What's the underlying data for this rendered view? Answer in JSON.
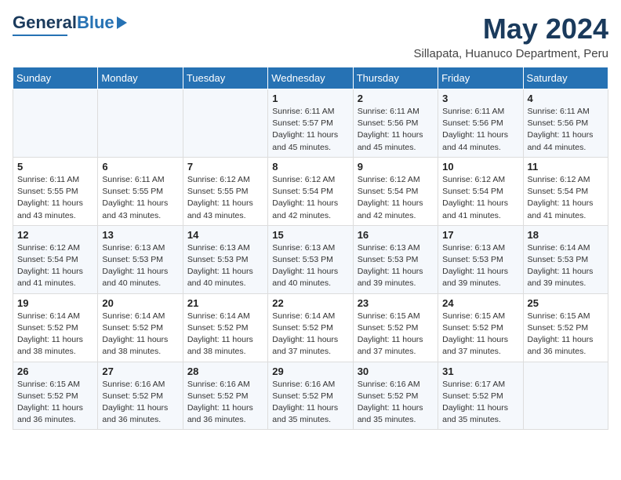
{
  "header": {
    "logo_general": "General",
    "logo_blue": "Blue",
    "month_year": "May 2024",
    "location": "Sillapata, Huanuco Department, Peru"
  },
  "days_of_week": [
    "Sunday",
    "Monday",
    "Tuesday",
    "Wednesday",
    "Thursday",
    "Friday",
    "Saturday"
  ],
  "weeks": [
    [
      {
        "day": "",
        "sunrise": "",
        "sunset": "",
        "daylight": ""
      },
      {
        "day": "",
        "sunrise": "",
        "sunset": "",
        "daylight": ""
      },
      {
        "day": "",
        "sunrise": "",
        "sunset": "",
        "daylight": ""
      },
      {
        "day": "1",
        "sunrise": "Sunrise: 6:11 AM",
        "sunset": "Sunset: 5:57 PM",
        "daylight": "Daylight: 11 hours and 45 minutes."
      },
      {
        "day": "2",
        "sunrise": "Sunrise: 6:11 AM",
        "sunset": "Sunset: 5:56 PM",
        "daylight": "Daylight: 11 hours and 45 minutes."
      },
      {
        "day": "3",
        "sunrise": "Sunrise: 6:11 AM",
        "sunset": "Sunset: 5:56 PM",
        "daylight": "Daylight: 11 hours and 44 minutes."
      },
      {
        "day": "4",
        "sunrise": "Sunrise: 6:11 AM",
        "sunset": "Sunset: 5:56 PM",
        "daylight": "Daylight: 11 hours and 44 minutes."
      }
    ],
    [
      {
        "day": "5",
        "sunrise": "Sunrise: 6:11 AM",
        "sunset": "Sunset: 5:55 PM",
        "daylight": "Daylight: 11 hours and 43 minutes."
      },
      {
        "day": "6",
        "sunrise": "Sunrise: 6:11 AM",
        "sunset": "Sunset: 5:55 PM",
        "daylight": "Daylight: 11 hours and 43 minutes."
      },
      {
        "day": "7",
        "sunrise": "Sunrise: 6:12 AM",
        "sunset": "Sunset: 5:55 PM",
        "daylight": "Daylight: 11 hours and 43 minutes."
      },
      {
        "day": "8",
        "sunrise": "Sunrise: 6:12 AM",
        "sunset": "Sunset: 5:54 PM",
        "daylight": "Daylight: 11 hours and 42 minutes."
      },
      {
        "day": "9",
        "sunrise": "Sunrise: 6:12 AM",
        "sunset": "Sunset: 5:54 PM",
        "daylight": "Daylight: 11 hours and 42 minutes."
      },
      {
        "day": "10",
        "sunrise": "Sunrise: 6:12 AM",
        "sunset": "Sunset: 5:54 PM",
        "daylight": "Daylight: 11 hours and 41 minutes."
      },
      {
        "day": "11",
        "sunrise": "Sunrise: 6:12 AM",
        "sunset": "Sunset: 5:54 PM",
        "daylight": "Daylight: 11 hours and 41 minutes."
      }
    ],
    [
      {
        "day": "12",
        "sunrise": "Sunrise: 6:12 AM",
        "sunset": "Sunset: 5:54 PM",
        "daylight": "Daylight: 11 hours and 41 minutes."
      },
      {
        "day": "13",
        "sunrise": "Sunrise: 6:13 AM",
        "sunset": "Sunset: 5:53 PM",
        "daylight": "Daylight: 11 hours and 40 minutes."
      },
      {
        "day": "14",
        "sunrise": "Sunrise: 6:13 AM",
        "sunset": "Sunset: 5:53 PM",
        "daylight": "Daylight: 11 hours and 40 minutes."
      },
      {
        "day": "15",
        "sunrise": "Sunrise: 6:13 AM",
        "sunset": "Sunset: 5:53 PM",
        "daylight": "Daylight: 11 hours and 40 minutes."
      },
      {
        "day": "16",
        "sunrise": "Sunrise: 6:13 AM",
        "sunset": "Sunset: 5:53 PM",
        "daylight": "Daylight: 11 hours and 39 minutes."
      },
      {
        "day": "17",
        "sunrise": "Sunrise: 6:13 AM",
        "sunset": "Sunset: 5:53 PM",
        "daylight": "Daylight: 11 hours and 39 minutes."
      },
      {
        "day": "18",
        "sunrise": "Sunrise: 6:14 AM",
        "sunset": "Sunset: 5:53 PM",
        "daylight": "Daylight: 11 hours and 39 minutes."
      }
    ],
    [
      {
        "day": "19",
        "sunrise": "Sunrise: 6:14 AM",
        "sunset": "Sunset: 5:52 PM",
        "daylight": "Daylight: 11 hours and 38 minutes."
      },
      {
        "day": "20",
        "sunrise": "Sunrise: 6:14 AM",
        "sunset": "Sunset: 5:52 PM",
        "daylight": "Daylight: 11 hours and 38 minutes."
      },
      {
        "day": "21",
        "sunrise": "Sunrise: 6:14 AM",
        "sunset": "Sunset: 5:52 PM",
        "daylight": "Daylight: 11 hours and 38 minutes."
      },
      {
        "day": "22",
        "sunrise": "Sunrise: 6:14 AM",
        "sunset": "Sunset: 5:52 PM",
        "daylight": "Daylight: 11 hours and 37 minutes."
      },
      {
        "day": "23",
        "sunrise": "Sunrise: 6:15 AM",
        "sunset": "Sunset: 5:52 PM",
        "daylight": "Daylight: 11 hours and 37 minutes."
      },
      {
        "day": "24",
        "sunrise": "Sunrise: 6:15 AM",
        "sunset": "Sunset: 5:52 PM",
        "daylight": "Daylight: 11 hours and 37 minutes."
      },
      {
        "day": "25",
        "sunrise": "Sunrise: 6:15 AM",
        "sunset": "Sunset: 5:52 PM",
        "daylight": "Daylight: 11 hours and 36 minutes."
      }
    ],
    [
      {
        "day": "26",
        "sunrise": "Sunrise: 6:15 AM",
        "sunset": "Sunset: 5:52 PM",
        "daylight": "Daylight: 11 hours and 36 minutes."
      },
      {
        "day": "27",
        "sunrise": "Sunrise: 6:16 AM",
        "sunset": "Sunset: 5:52 PM",
        "daylight": "Daylight: 11 hours and 36 minutes."
      },
      {
        "day": "28",
        "sunrise": "Sunrise: 6:16 AM",
        "sunset": "Sunset: 5:52 PM",
        "daylight": "Daylight: 11 hours and 36 minutes."
      },
      {
        "day": "29",
        "sunrise": "Sunrise: 6:16 AM",
        "sunset": "Sunset: 5:52 PM",
        "daylight": "Daylight: 11 hours and 35 minutes."
      },
      {
        "day": "30",
        "sunrise": "Sunrise: 6:16 AM",
        "sunset": "Sunset: 5:52 PM",
        "daylight": "Daylight: 11 hours and 35 minutes."
      },
      {
        "day": "31",
        "sunrise": "Sunrise: 6:17 AM",
        "sunset": "Sunset: 5:52 PM",
        "daylight": "Daylight: 11 hours and 35 minutes."
      },
      {
        "day": "",
        "sunrise": "",
        "sunset": "",
        "daylight": ""
      }
    ]
  ]
}
